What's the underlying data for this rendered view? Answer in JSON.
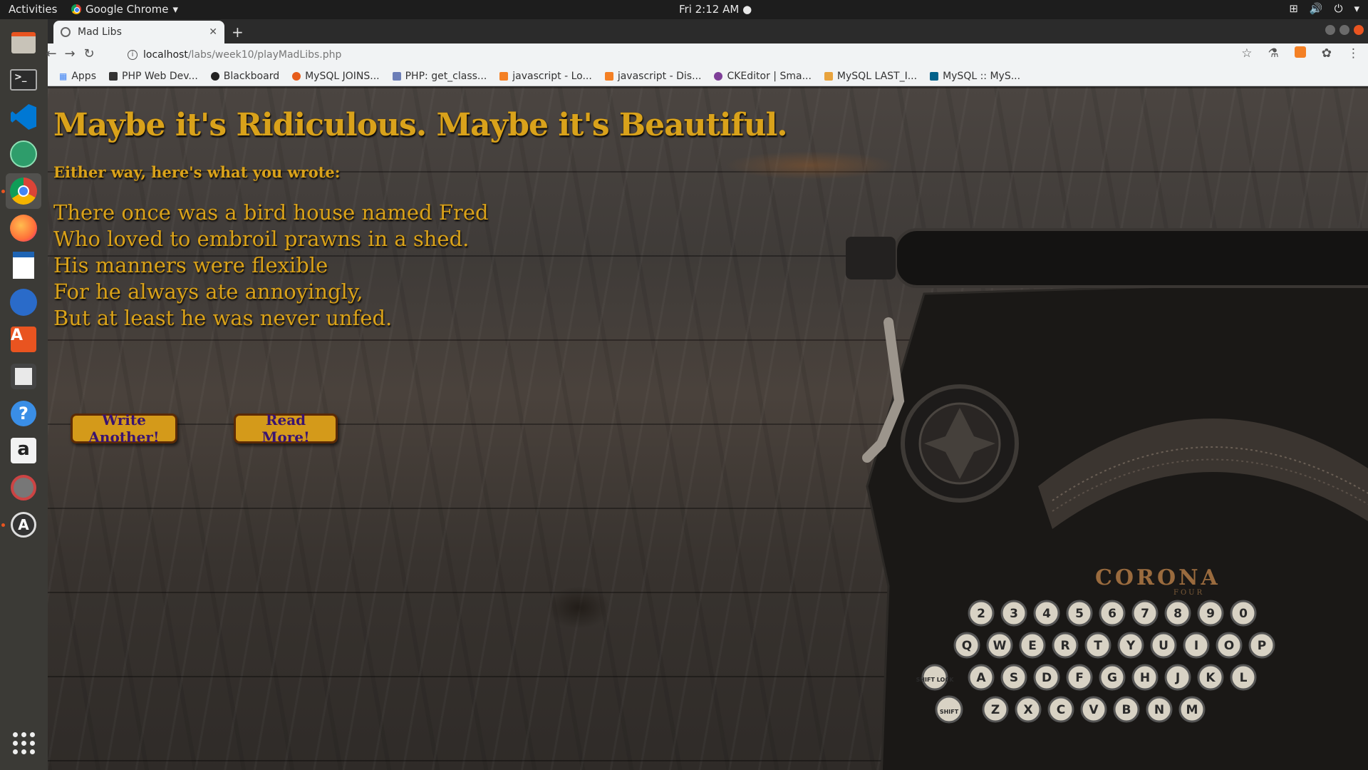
{
  "system": {
    "activities": "Activities",
    "app_name": "Google Chrome",
    "clock": "Fri  2:12 AM"
  },
  "browser": {
    "tab_title": "Mad Libs",
    "url_host": "localhost",
    "url_path": "/labs/week10/playMadLibs.php",
    "bookmarks": [
      {
        "label": "Apps",
        "color": "#4285f4"
      },
      {
        "label": "PHP Web Dev...",
        "color": "#333333"
      },
      {
        "label": "Blackboard",
        "color": "#222222"
      },
      {
        "label": "MySQL JOINS...",
        "color": "#e65c1a"
      },
      {
        "label": "PHP: get_class...",
        "color": "#6c7eb7"
      },
      {
        "label": "javascript - Lo...",
        "color": "#f48024"
      },
      {
        "label": "javascript - Dis...",
        "color": "#f48024"
      },
      {
        "label": "CKEditor | Sma...",
        "color": "#7e3f98"
      },
      {
        "label": "MySQL LAST_I...",
        "color": "#e8a33d"
      },
      {
        "label": "MySQL :: MyS...",
        "color": "#00618a"
      }
    ]
  },
  "page": {
    "heading": "Maybe it's Ridiculous. Maybe it's Beautiful.",
    "subheading": "Either way, here's what you wrote:",
    "poem": [
      "There once was a bird house named Fred",
      "Who loved to embroil prawns in a shed.",
      "His manners were flexible",
      "For he always ate annoyingly,",
      "But at least he was never unfed."
    ],
    "buttons": {
      "write_another": "Write Another!",
      "read_more": "Read More!"
    },
    "typewriter_brand": "CORONA",
    "typewriter_model": "FOUR",
    "key_rows": [
      [
        "2",
        "3",
        "4",
        "5",
        "6",
        "7",
        "8",
        "9",
        "0"
      ],
      [
        "Q",
        "W",
        "E",
        "R",
        "T",
        "Y",
        "U",
        "I",
        "O",
        "P"
      ],
      [
        "A",
        "S",
        "D",
        "F",
        "G",
        "H",
        "J",
        "K",
        "L"
      ],
      [
        "Z",
        "X",
        "C",
        "V",
        "B",
        "N",
        "M"
      ]
    ],
    "shift_lock_label": "SHIFT LOCK",
    "shift_label": "SHIFT"
  },
  "colors": {
    "text_gold": "#d9a21b",
    "button_bg": "#d49a1a",
    "button_text": "#3a1470",
    "ubuntu_orange": "#e95420"
  }
}
